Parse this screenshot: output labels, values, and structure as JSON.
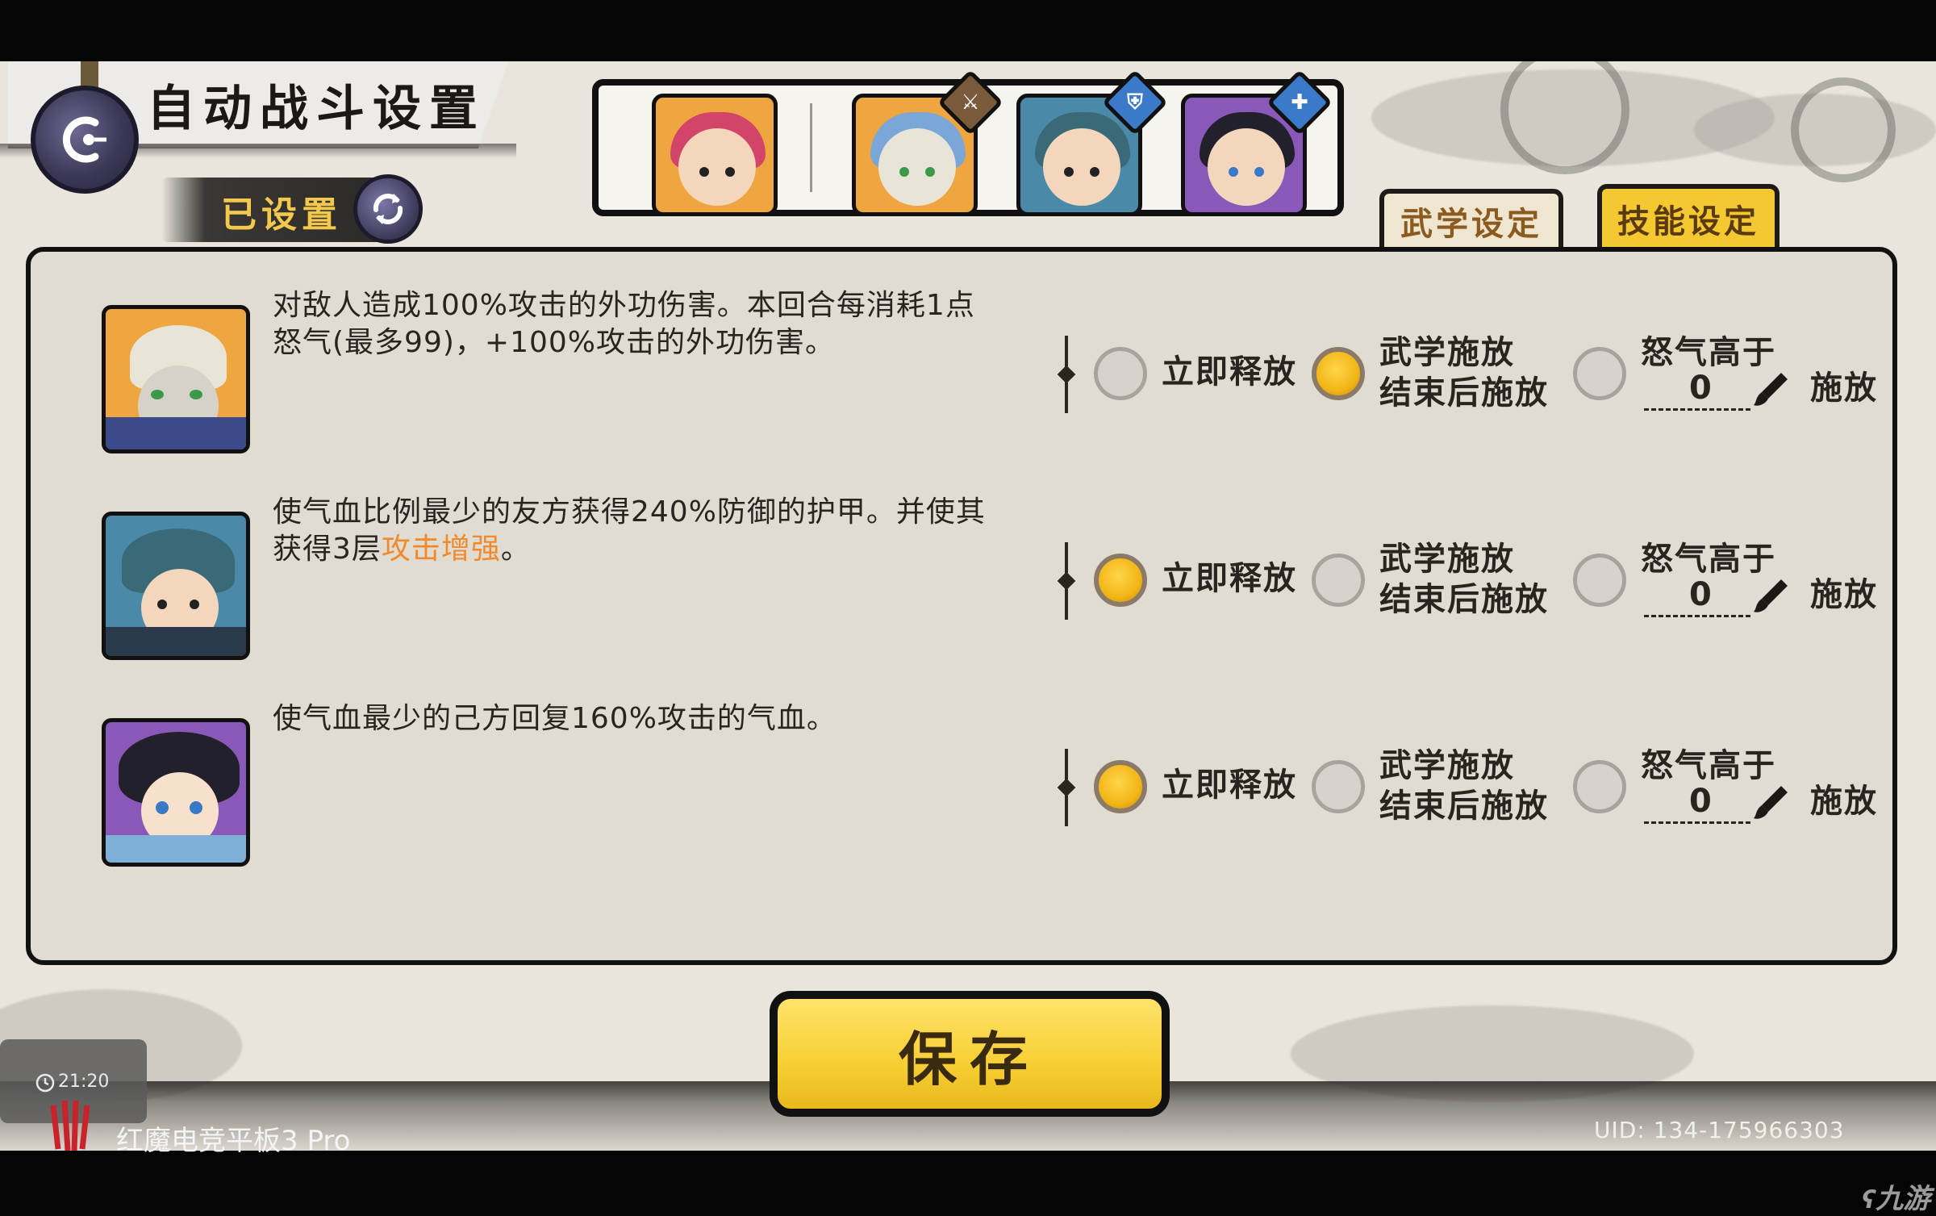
{
  "header": {
    "title": "自动战斗设置",
    "subtitle": "已设置"
  },
  "tabs": [
    {
      "label": "武学设定",
      "active": false
    },
    {
      "label": "技能设定",
      "active": true
    }
  ],
  "heroes": [
    {
      "name": "hero-1",
      "badge": ""
    },
    {
      "name": "hero-2",
      "badge": "sword"
    },
    {
      "name": "hero-3",
      "badge": "shield"
    },
    {
      "name": "hero-4",
      "badge": "heal"
    }
  ],
  "skills": [
    {
      "desc_line1": "对敌人造成100%攻击的外功伤害。本回合每消耗1点",
      "desc_line2": "怒气(最多99)，+100%攻击的外功伤害。",
      "desc_highlight": "",
      "desc_tail": "",
      "selected": 1
    },
    {
      "desc_line1": "使气血比例最少的友方获得240%防御的护甲。并使其",
      "desc_line2": "获得3层",
      "desc_highlight": "攻击增强",
      "desc_tail": "。",
      "selected": 0
    },
    {
      "desc_line1": "使气血最少的己方回复160%攻击的气血。",
      "desc_line2": "",
      "desc_highlight": "",
      "desc_tail": "",
      "selected": 0
    }
  ],
  "options": {
    "immediate": "立即释放",
    "after_martial_1": "武学施放",
    "after_martial_2": "结束后施放",
    "rage_1": "怒气高于",
    "rage_value": "0",
    "rage_2": "施放"
  },
  "save_label": "保存",
  "uid": "UID:  134-175966303",
  "overlay": {
    "time": "21:20",
    "device": "红魔电竞平板3 Pro",
    "watermark": "九游"
  },
  "colors": {
    "accent_yellow": "#f4c830",
    "highlight_orange": "#f08a2c",
    "panel_bg": "#e1dcd2"
  }
}
